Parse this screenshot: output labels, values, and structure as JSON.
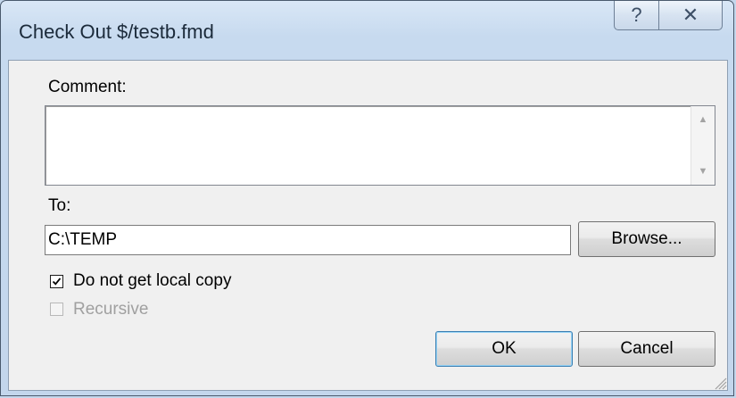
{
  "window": {
    "title": "Check Out $/testb.fmd"
  },
  "caption_buttons": {
    "help_icon": "help-icon",
    "close_icon": "close-icon",
    "help_glyph": "?",
    "close_glyph": "✕"
  },
  "form": {
    "comment_label": "Comment:",
    "comment_value": "",
    "to_label": "To:",
    "to_value": "C:\\TEMP",
    "browse_label": "Browse...",
    "no_local_copy": {
      "label": "Do not get local copy",
      "checked": true,
      "enabled": true
    },
    "recursive": {
      "label": "Recursive",
      "checked": false,
      "enabled": false
    }
  },
  "buttons": {
    "ok_label": "OK",
    "cancel_label": "Cancel"
  },
  "colors": {
    "accent": "#3c7fb1",
    "frame": "#c3d6ec",
    "client": "#f0f0f0"
  }
}
